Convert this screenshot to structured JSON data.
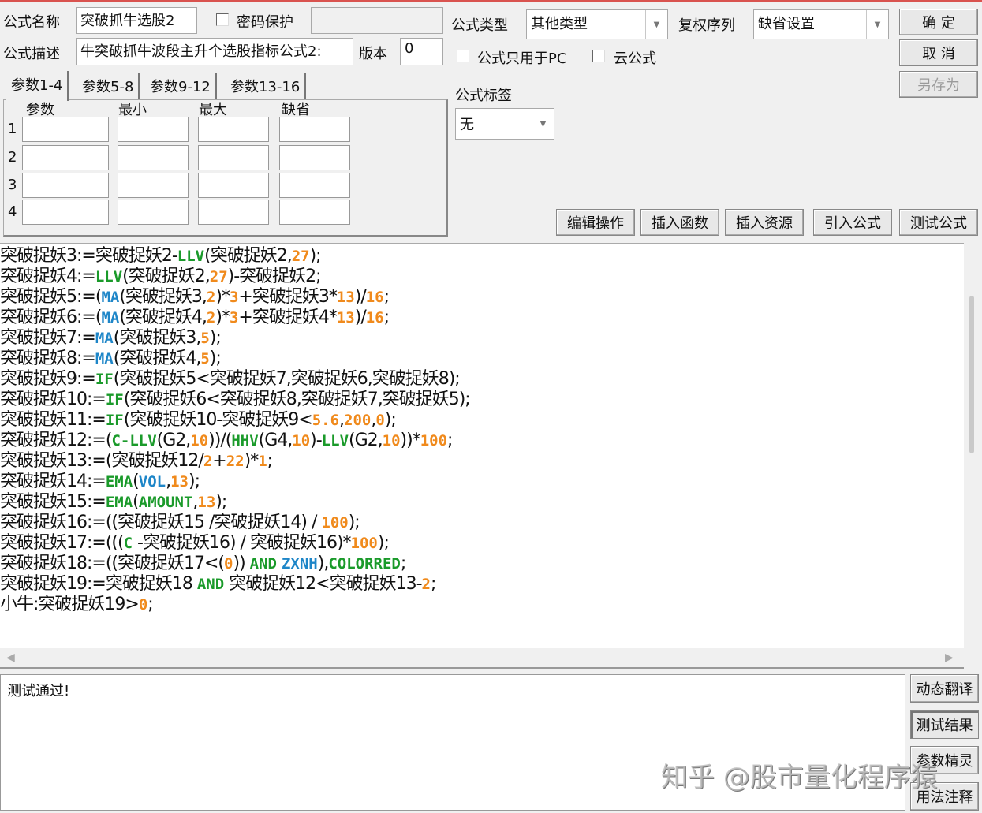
{
  "header": {
    "name_label": "公式名称",
    "name_value": "突破抓牛选股2",
    "password_label": "密码保护",
    "desc_label": "公式描述",
    "desc_value": "牛突破抓牛波段主升个选股指标公式2:",
    "version_label": "版本",
    "version_value": "0",
    "type_label": "公式类型",
    "type_value": "其他类型",
    "rights_label": "复权序列",
    "rights_value": "缺省设置",
    "pc_only_label": "公式只用于PC",
    "cloud_label": "云公式",
    "tag_label": "公式标签",
    "tag_value": "无",
    "ok": "确 定",
    "cancel": "取 消",
    "save_as": "另存为"
  },
  "params": {
    "tabs": [
      "参数1-4",
      "参数5-8",
      "参数9-12",
      "参数13-16"
    ],
    "columns": [
      "参数",
      "最小",
      "最大",
      "缺省"
    ],
    "rows": [
      "1",
      "2",
      "3",
      "4"
    ]
  },
  "toolbar": [
    "编辑操作",
    "插入函数",
    "插入资源",
    "引入公式",
    "测试公式"
  ],
  "colors": {
    "t": "#111111",
    "f": "#1a9a2a",
    "v": "#1e86c8",
    "n": "#f08a1c"
  },
  "code": [
    [
      [
        "t",
        "突破捉妖3:=突破捉妖2-"
      ],
      [
        "f",
        "LLV"
      ],
      [
        "t",
        "(突破捉妖2,"
      ],
      [
        "n",
        "27"
      ],
      [
        "t",
        ");"
      ]
    ],
    [
      [
        "t",
        "突破捉妖4:="
      ],
      [
        "f",
        "LLV"
      ],
      [
        "t",
        "(突破捉妖2,"
      ],
      [
        "n",
        "27"
      ],
      [
        "t",
        ")-突破捉妖2;"
      ]
    ],
    [
      [
        "t",
        "突破捉妖5:=("
      ],
      [
        "v",
        "MA"
      ],
      [
        "t",
        "(突破捉妖3,"
      ],
      [
        "n",
        "2"
      ],
      [
        "t",
        ")*"
      ],
      [
        "n",
        "3"
      ],
      [
        "t",
        "+突破捉妖3*"
      ],
      [
        "n",
        "13"
      ],
      [
        "t",
        ")/"
      ],
      [
        "n",
        "16"
      ],
      [
        "t",
        ";"
      ]
    ],
    [
      [
        "t",
        "突破捉妖6:=("
      ],
      [
        "v",
        "MA"
      ],
      [
        "t",
        "(突破捉妖4,"
      ],
      [
        "n",
        "2"
      ],
      [
        "t",
        ")*"
      ],
      [
        "n",
        "3"
      ],
      [
        "t",
        "+突破捉妖4*"
      ],
      [
        "n",
        "13"
      ],
      [
        "t",
        ")/"
      ],
      [
        "n",
        "16"
      ],
      [
        "t",
        ";"
      ]
    ],
    [
      [
        "t",
        "突破捉妖7:="
      ],
      [
        "v",
        "MA"
      ],
      [
        "t",
        "(突破捉妖3,"
      ],
      [
        "n",
        "5"
      ],
      [
        "t",
        ");"
      ]
    ],
    [
      [
        "t",
        "突破捉妖8:="
      ],
      [
        "v",
        "MA"
      ],
      [
        "t",
        "(突破捉妖4,"
      ],
      [
        "n",
        "5"
      ],
      [
        "t",
        ");"
      ]
    ],
    [
      [
        "t",
        "突破捉妖9:="
      ],
      [
        "f",
        "IF"
      ],
      [
        "t",
        "(突破捉妖5<突破捉妖7,突破捉妖6,突破捉妖8);"
      ]
    ],
    [
      [
        "t",
        "突破捉妖10:="
      ],
      [
        "f",
        "IF"
      ],
      [
        "t",
        "(突破捉妖6<突破捉妖8,突破捉妖7,突破捉妖5);"
      ]
    ],
    [
      [
        "t",
        "突破捉妖11:="
      ],
      [
        "f",
        "IF"
      ],
      [
        "t",
        "(突破捉妖10-突破捉妖9<"
      ],
      [
        "n",
        "5.6"
      ],
      [
        "t",
        ","
      ],
      [
        "n",
        "200"
      ],
      [
        "t",
        ","
      ],
      [
        "n",
        "0"
      ],
      [
        "t",
        ");"
      ]
    ],
    [
      [
        "t",
        "突破捉妖12:=("
      ],
      [
        "f",
        "C-LLV"
      ],
      [
        "t",
        "(G2,"
      ],
      [
        "n",
        "10"
      ],
      [
        "t",
        "))/("
      ],
      [
        "f",
        "HHV"
      ],
      [
        "t",
        "(G4,"
      ],
      [
        "n",
        "10"
      ],
      [
        "t",
        ")-"
      ],
      [
        "f",
        "LLV"
      ],
      [
        "t",
        "(G2,"
      ],
      [
        "n",
        "10"
      ],
      [
        "t",
        "))*"
      ],
      [
        "n",
        "100"
      ],
      [
        "t",
        ";"
      ]
    ],
    [
      [
        "t",
        "突破捉妖13:=(突破捉妖12/"
      ],
      [
        "n",
        "2"
      ],
      [
        "t",
        "+"
      ],
      [
        "n",
        "22"
      ],
      [
        "t",
        ")*"
      ],
      [
        "n",
        "1"
      ],
      [
        "t",
        ";"
      ]
    ],
    [
      [
        "t",
        "突破捉妖14:="
      ],
      [
        "f",
        "EMA"
      ],
      [
        "t",
        "("
      ],
      [
        "v",
        "VOL"
      ],
      [
        "t",
        ","
      ],
      [
        "n",
        "13"
      ],
      [
        "t",
        ");"
      ]
    ],
    [
      [
        "t",
        "突破捉妖15:="
      ],
      [
        "f",
        "EMA"
      ],
      [
        "t",
        "("
      ],
      [
        "f",
        "AMOUNT"
      ],
      [
        "t",
        ","
      ],
      [
        "n",
        "13"
      ],
      [
        "t",
        ");"
      ]
    ],
    [
      [
        "t",
        "突破捉妖16:=((突破捉妖15 /突破捉妖14) / "
      ],
      [
        "n",
        "100"
      ],
      [
        "t",
        ");"
      ]
    ],
    [
      [
        "t",
        "突破捉妖17:=((("
      ],
      [
        "f",
        "C"
      ],
      [
        "t",
        " -突破捉妖16) / 突破捉妖16)*"
      ],
      [
        "n",
        "100"
      ],
      [
        "t",
        ");"
      ]
    ],
    [
      [
        "t",
        "突破捉妖18:=((突破捉妖17<("
      ],
      [
        "n",
        "0"
      ],
      [
        "t",
        ")) "
      ],
      [
        "f",
        "AND"
      ],
      [
        "t",
        " "
      ],
      [
        "v",
        "ZXNH"
      ],
      [
        "t",
        "),"
      ],
      [
        "f",
        "COLORRED"
      ],
      [
        "t",
        ";"
      ]
    ],
    [
      [
        "t",
        "突破捉妖19:=突破捉妖18 "
      ],
      [
        "f",
        "AND"
      ],
      [
        "t",
        " 突破捉妖12<突破捉妖13-"
      ],
      [
        "n",
        "2"
      ],
      [
        "t",
        ";"
      ]
    ],
    [
      [
        "t",
        "小牛:突破捉妖19>"
      ],
      [
        "n",
        "0"
      ],
      [
        "t",
        ";"
      ]
    ]
  ],
  "output": {
    "message": "测试通过!"
  },
  "side_buttons": [
    "动态翻译",
    "测试结果",
    "参数精灵",
    "用法注释"
  ],
  "watermark": "知乎 @股市量化程序猿"
}
